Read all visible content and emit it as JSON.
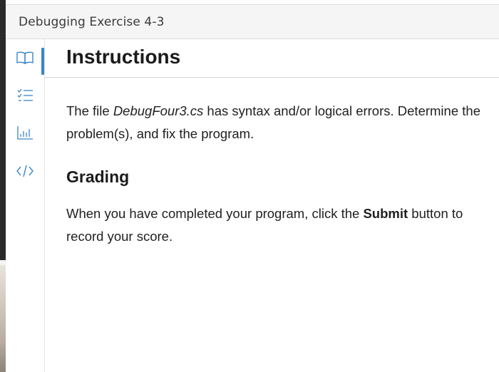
{
  "window": {
    "title": "Debugging Exercise 4-3"
  },
  "sidebar": {
    "items": [
      {
        "name": "instructions",
        "icon": "book-icon",
        "active": true
      },
      {
        "name": "checklist",
        "icon": "checklist-icon",
        "active": false
      },
      {
        "name": "results",
        "icon": "bar-chart-icon",
        "active": false
      },
      {
        "name": "code",
        "icon": "code-icon",
        "active": false
      }
    ],
    "accent_color": "#3b86c8"
  },
  "main": {
    "header": "Instructions",
    "intro": {
      "before": "The file ",
      "filename": "DebugFour3.cs",
      "after": " has syntax and/or logical errors. Determine the problem(s), and fix the program."
    },
    "grading_heading": "Grading",
    "grading": {
      "before": "When you have completed your program, click the ",
      "button_name": "Submit",
      "after": " button to record your score."
    }
  }
}
